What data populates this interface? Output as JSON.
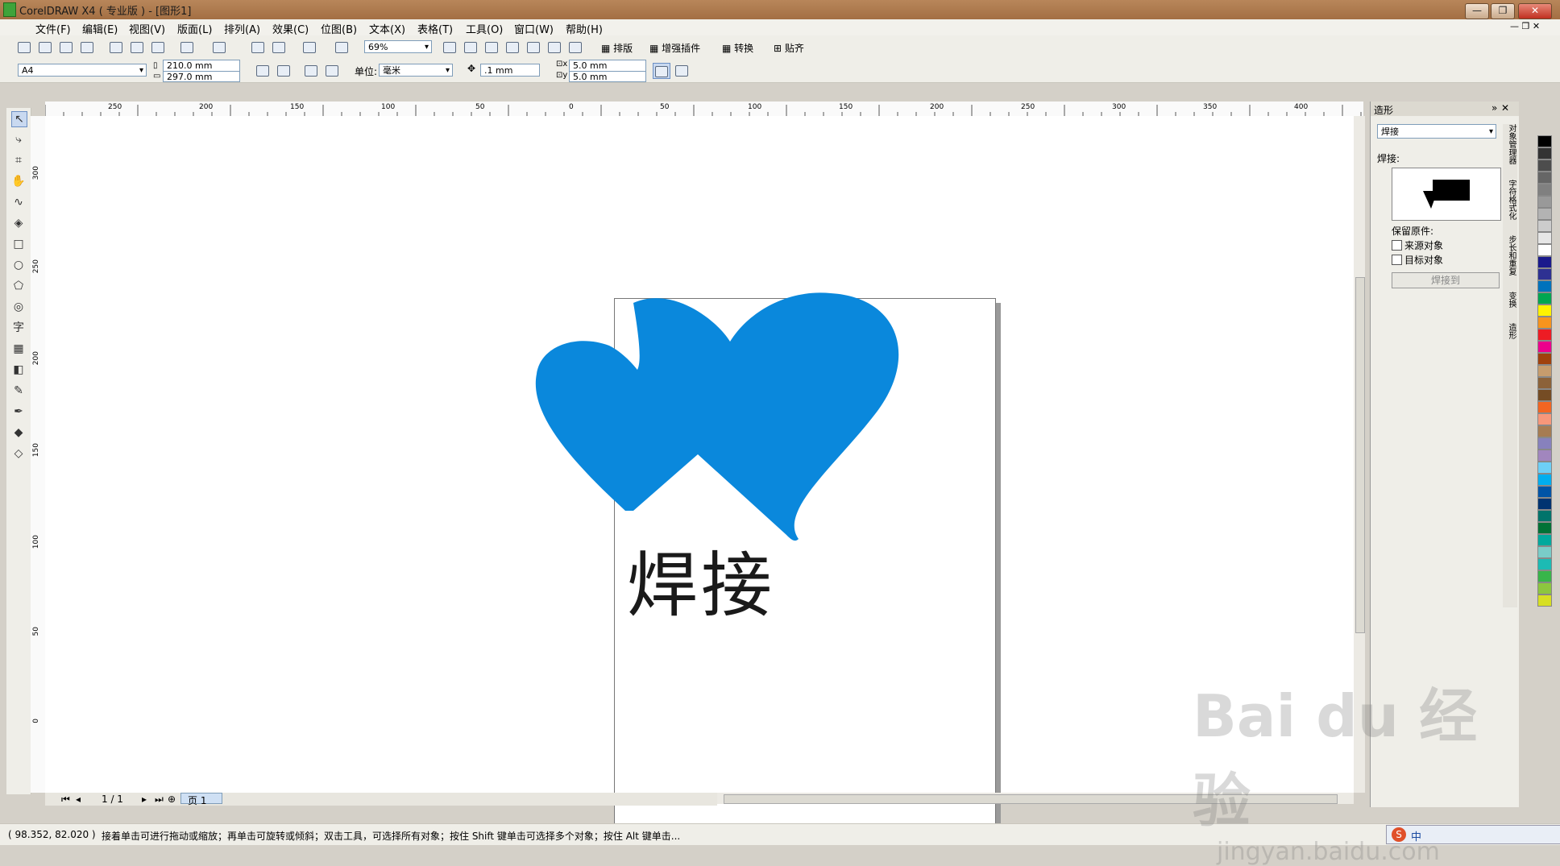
{
  "window": {
    "title": "CorelDRAW X4 ( 专业版 ) - [图形1]",
    "controls": {
      "minimize": "—",
      "restore": "❐",
      "close": "✕"
    }
  },
  "menu": [
    "文件(F)",
    "编辑(E)",
    "视图(V)",
    "版面(L)",
    "排列(A)",
    "效果(C)",
    "位图(B)",
    "文本(X)",
    "表格(T)",
    "工具(O)",
    "窗口(W)",
    "帮助(H)"
  ],
  "toolbar": {
    "zoom": "69%",
    "buttons": [
      "排版",
      "增强插件",
      "转换",
      "贴齐"
    ]
  },
  "property_bar": {
    "paper": "A4",
    "width": "210.0 mm",
    "height": "297.0 mm",
    "unit_label": "单位:",
    "unit": "毫米",
    "nudge": ".1 mm",
    "dup_x": "5.0 mm",
    "dup_y": "5.0 mm"
  },
  "rulers": {
    "top": [
      "250",
      "200",
      "150",
      "100",
      "50",
      "0",
      "50",
      "100",
      "150",
      "200",
      "250",
      "300",
      "350",
      "400"
    ],
    "left": [
      "300",
      "250",
      "200",
      "150",
      "100",
      "50",
      "0"
    ]
  },
  "canvas": {
    "shape_color": "#0a88dc",
    "text": "焊接"
  },
  "page_nav": {
    "count": "1 / 1",
    "tab": "页 1"
  },
  "docker": {
    "title": "造形",
    "mode": "焊接",
    "section": "焊接:",
    "keep_label": "保留原件:",
    "option_source": "来源对象",
    "option_target": "目标对象",
    "apply_button": "焊接到",
    "side_tabs": [
      "对象管理器",
      "字符格式化",
      "步长和重复",
      "变换",
      "造形"
    ]
  },
  "palette": [
    "#000000",
    "#333333",
    "#4d4d4d",
    "#666666",
    "#808080",
    "#999999",
    "#b3b3b3",
    "#cccccc",
    "#e6e6e6",
    "#ffffff",
    "#1a1a8c",
    "#2e3192",
    "#0072bc",
    "#00a651",
    "#fff200",
    "#f7941d",
    "#ed1c24",
    "#ec008c",
    "#a0410d",
    "#c69c6d",
    "#8c6239",
    "#754c24",
    "#f26522",
    "#f7977a",
    "#a67c52",
    "#8781bd",
    "#a186be",
    "#6dcff6",
    "#00aeef",
    "#0054a6",
    "#003471",
    "#00746b",
    "#007236",
    "#00a99d",
    "#7accc8",
    "#1cbbb4",
    "#39b54a",
    "#8dc63f",
    "#d7df23"
  ],
  "status": {
    "coords": "( 98.352, 82.020 )",
    "hint": "接着单击可进行拖动或缩放；再单击可旋转或倾斜；双击工具，可选择所有对象；按住 Shift 键单击可选择多个对象；按住 Alt 键单击..."
  },
  "watermark": {
    "brand": "Bai du 经验",
    "url": "jingyan.baidu.com"
  },
  "ime": {
    "label": "中"
  }
}
